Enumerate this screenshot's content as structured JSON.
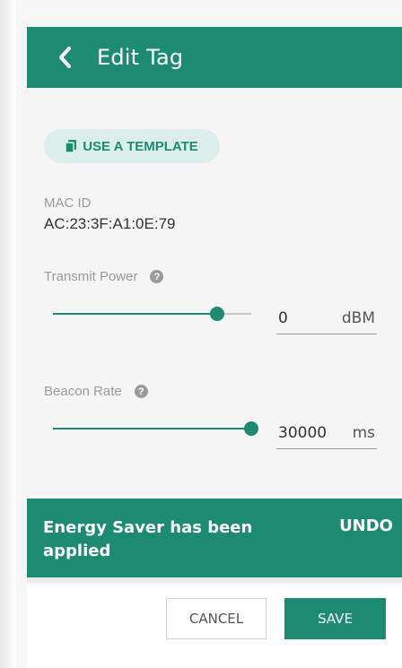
{
  "header": {
    "title": "Edit Tag",
    "back_icon": "chevron-left-icon"
  },
  "template_button": {
    "label": "USE A TEMPLATE",
    "icon": "copy-icon"
  },
  "mac": {
    "label": "MAC ID",
    "value": "AC:23:3F:A1:0E:79"
  },
  "transmit_power": {
    "label": "Transmit Power",
    "help_icon": "help-icon",
    "help_glyph": "?",
    "value": "0",
    "unit": "dBM",
    "slider_fraction": 0.83
  },
  "beacon_rate": {
    "label": "Beacon Rate",
    "help_icon": "help-icon",
    "help_glyph": "?",
    "value": "30000",
    "unit": "ms",
    "slider_fraction": 1.0
  },
  "snackbar": {
    "message": "Energy Saver has been applied",
    "action": "UNDO"
  },
  "footer": {
    "cancel_label": "CANCEL",
    "save_label": "SAVE"
  },
  "colors": {
    "accent": "#1c8b72",
    "template_bg": "#dceee9"
  }
}
